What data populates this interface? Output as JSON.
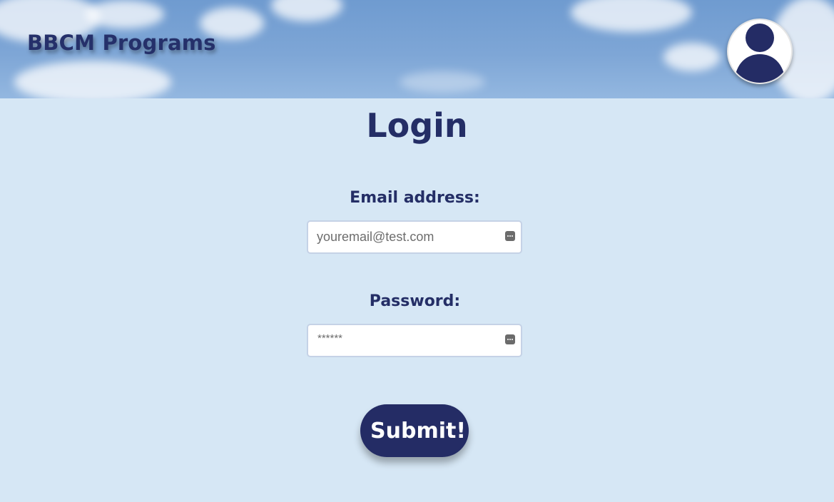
{
  "header": {
    "site_title": "BBCM Programs",
    "avatar_icon": "user-avatar-icon"
  },
  "login": {
    "title": "Login",
    "email_label": "Email address:",
    "email_placeholder": "youremail@test.com",
    "email_value": "",
    "password_label": "Password:",
    "password_placeholder": "******",
    "password_value": "",
    "autofill_icon": "password-manager-key-icon",
    "submit_label": "Submit!"
  },
  "colors": {
    "background": "#d6e7f5",
    "primary": "#242c65",
    "sky": "#7ea6d6"
  }
}
